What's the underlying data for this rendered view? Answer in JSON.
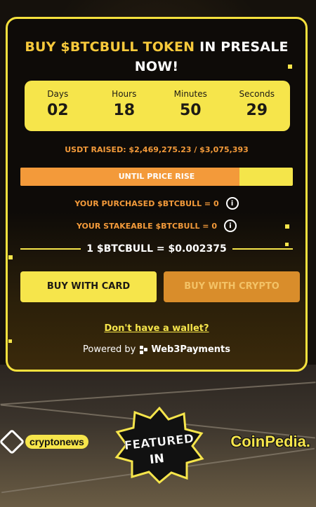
{
  "presale": {
    "title_accent": "BUY $BTCBULL TOKEN",
    "title_rest": " IN PRESALE",
    "title_line2": "NOW!"
  },
  "countdown": [
    {
      "label": "Days",
      "value": "02"
    },
    {
      "label": "Hours",
      "value": "18"
    },
    {
      "label": "Minutes",
      "value": "50"
    },
    {
      "label": "Seconds",
      "value": "29"
    }
  ],
  "raised": {
    "text": "USDT RAISED: $2,469,275.23 / $3,075,393",
    "progress_fraction": 0.803
  },
  "progress_label": "UNTIL PRICE RISE",
  "purchased": {
    "label": "YOUR PURCHASED $BTCBULL  =  0"
  },
  "stakeable": {
    "label": "YOUR STAKEABLE $BTCBULL  =  0"
  },
  "info_icon": "i",
  "price": "1 $BTCBULL = $0.002375",
  "buttons": {
    "buy_card": "BUY WITH CARD",
    "buy_crypto": "BUY WITH CRYPTO"
  },
  "no_wallet": "Don't have a wallet?",
  "powered": {
    "prefix": "Powered by",
    "brand": "Web3Payments"
  },
  "featured": {
    "cryptonews": "cryptonews",
    "badge_line1": "FEATURED",
    "badge_line2": "IN",
    "coinpedia": "CoinPedia."
  },
  "colors": {
    "accent_yellow": "#f6e54b",
    "accent_orange": "#f39a3a",
    "crypto_button": "#d98d2b"
  }
}
